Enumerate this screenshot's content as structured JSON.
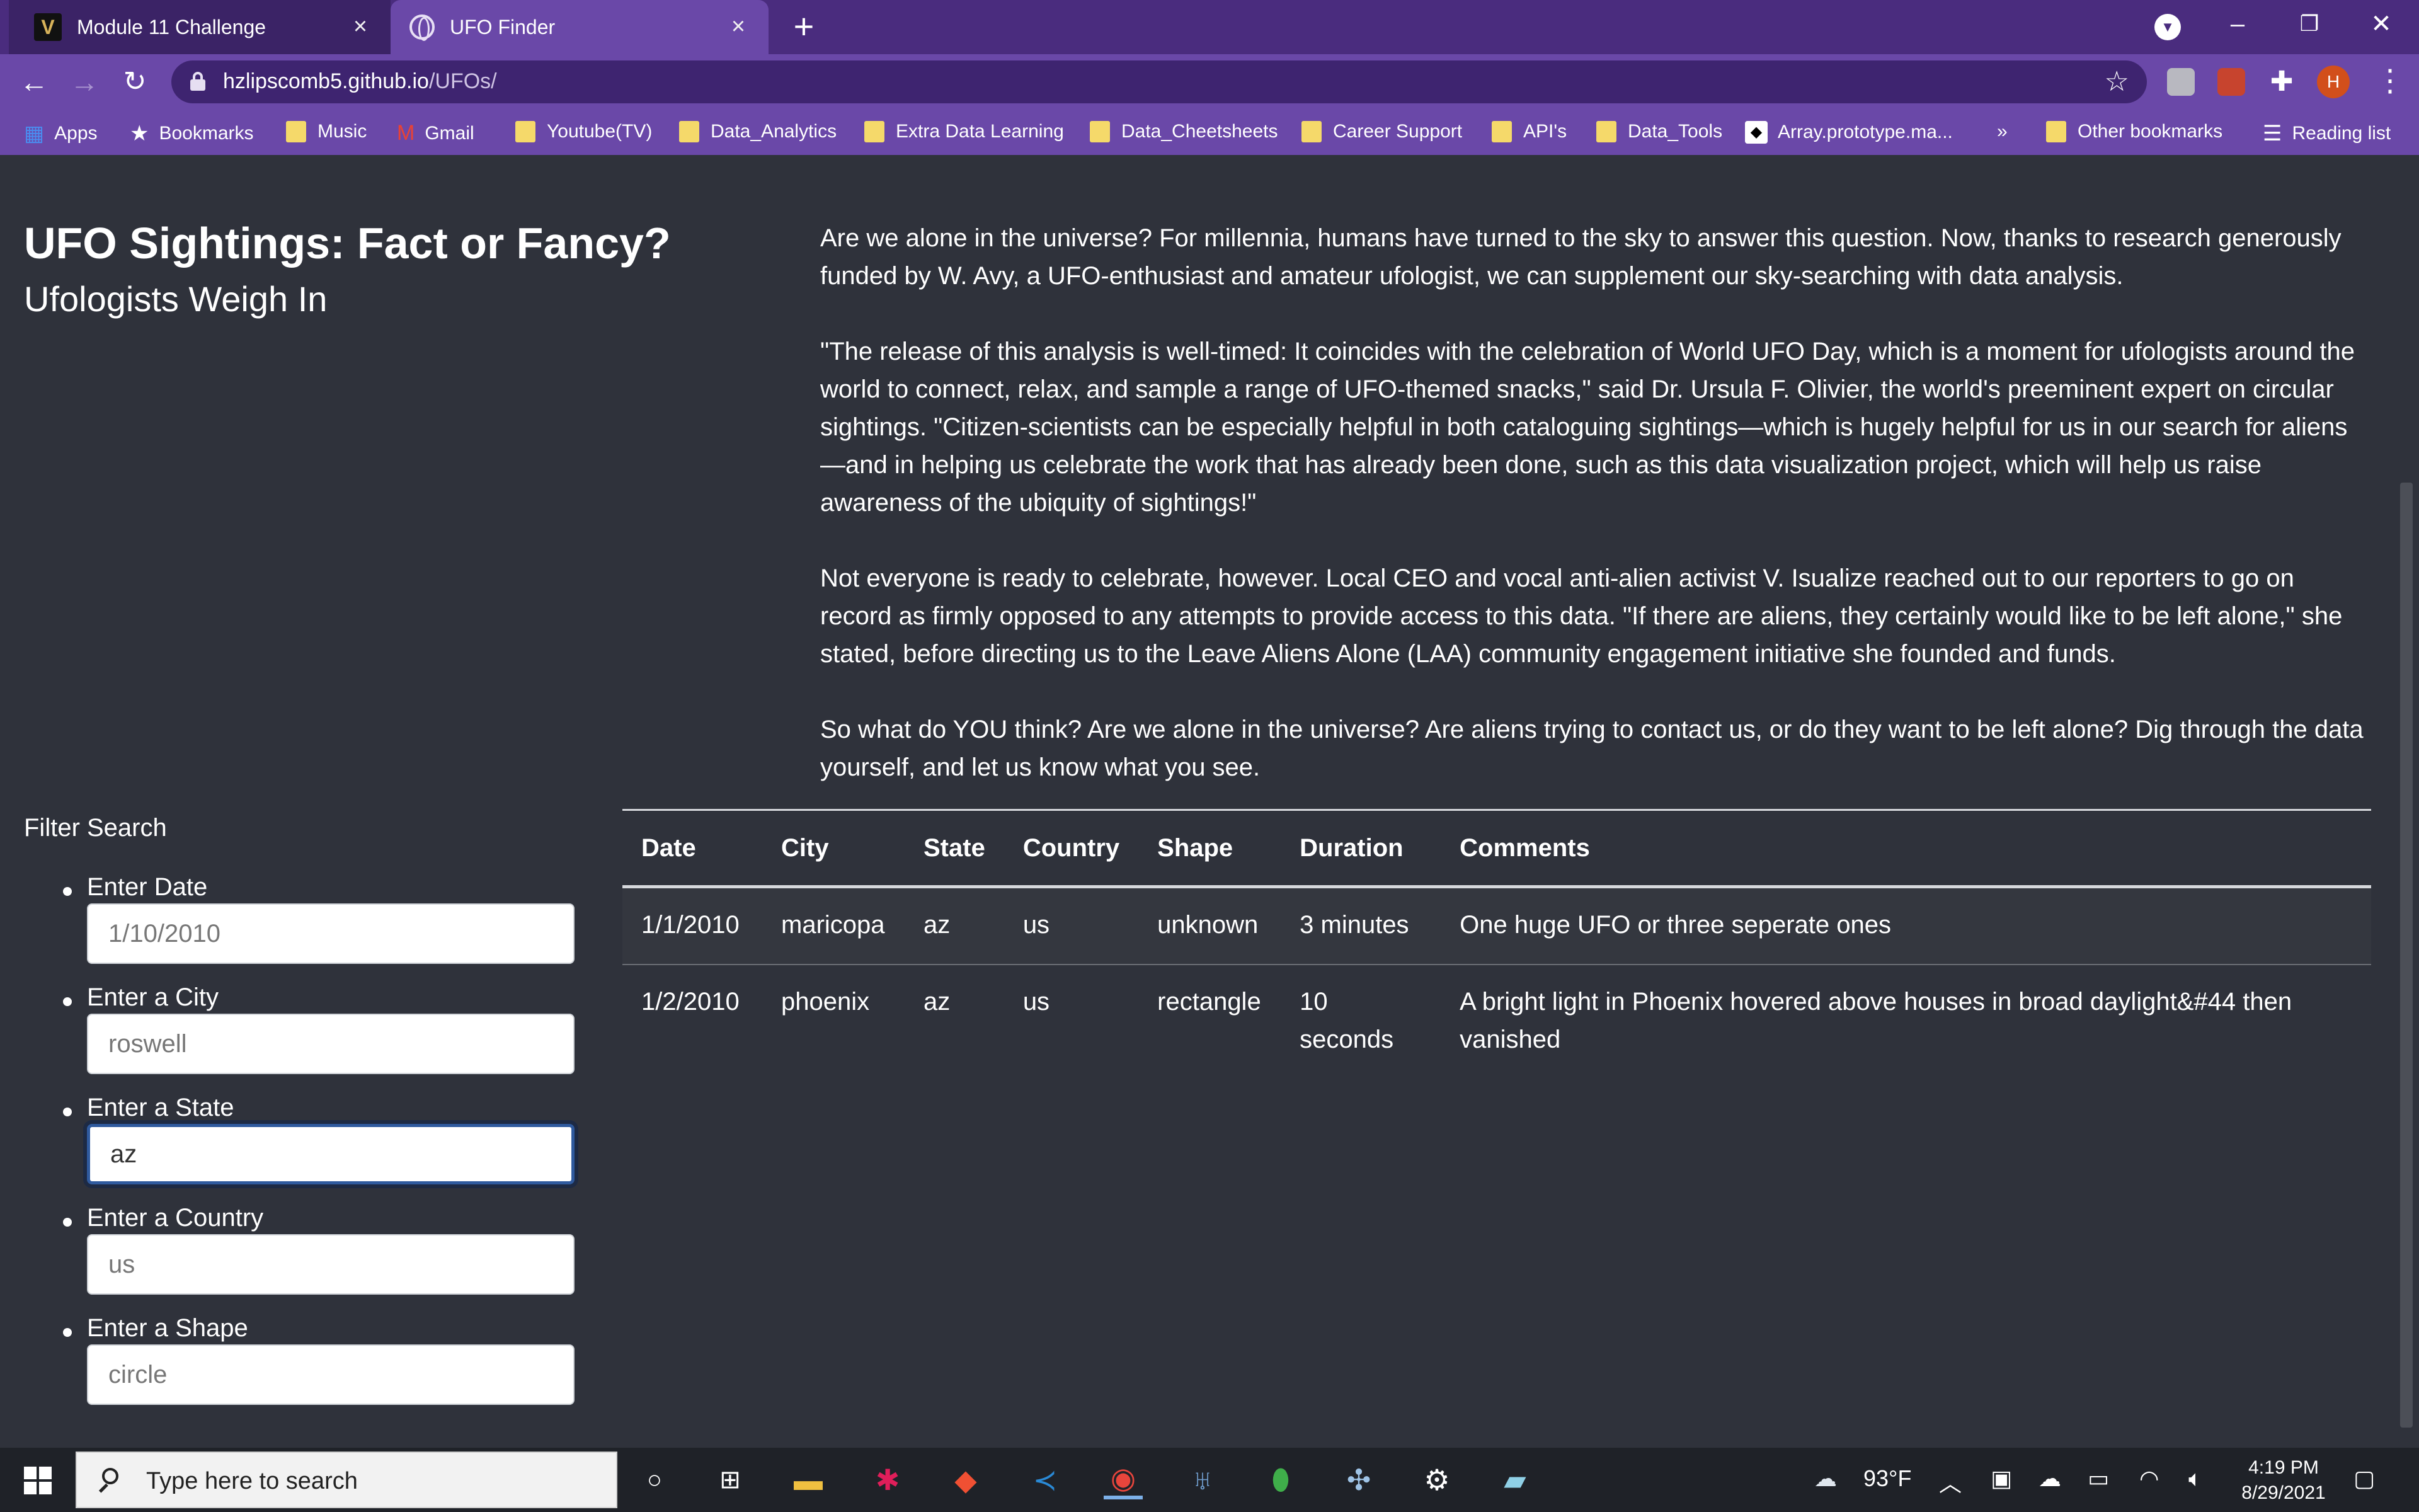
{
  "browser": {
    "tabs": [
      {
        "title": "Module 11 Challenge",
        "favicon": "v-logo-icon",
        "active": false
      },
      {
        "title": "UFO Finder",
        "favicon": "globe-icon",
        "active": true
      }
    ],
    "url_host": "hzlipscomb5.github.io",
    "url_path": "/UFOs/",
    "profile_initial": "H",
    "bookmarks": [
      {
        "label": "Apps",
        "icon": "apps-icon"
      },
      {
        "label": "Bookmarks",
        "icon": "star-icon"
      },
      {
        "label": "Music",
        "icon": "folder-icon"
      },
      {
        "label": "Gmail",
        "icon": "gmail-icon"
      },
      {
        "label": "Youtube(TV)",
        "icon": "folder-icon"
      },
      {
        "label": "Data_Analytics",
        "icon": "folder-icon"
      },
      {
        "label": "Extra Data Learning",
        "icon": "folder-icon"
      },
      {
        "label": "Data_Cheetsheets",
        "icon": "folder-icon"
      },
      {
        "label": "Career Support",
        "icon": "folder-icon"
      },
      {
        "label": "API's",
        "icon": "folder-icon"
      },
      {
        "label": "Data_Tools",
        "icon": "folder-icon"
      },
      {
        "label": "Array.prototype.ma...",
        "icon": "site-icon"
      }
    ],
    "overflow_label": "»",
    "other_bookmarks": "Other bookmarks",
    "reading_list": "Reading list"
  },
  "page": {
    "title": "UFO Sightings: Fact or Fancy?",
    "subtitle": "Ufologists Weigh In",
    "paragraphs": [
      "Are we alone in the universe? For millennia, humans have turned to the sky to answer this question. Now, thanks to research generously funded by W. Avy, a UFO-enthusiast and amateur ufologist, we can supplement our sky-searching with data analysis.",
      "\"The release of this analysis is well-timed: It coincides with the celebration of World UFO Day, which is a moment for ufologists around the world to connect, relax, and sample a range of UFO-themed snacks,\" said Dr. Ursula F. Olivier, the world's preeminent expert on circular sightings. \"Citizen-scientists can be especially helpful in both cataloguing sightings—which is hugely helpful for us in our search for aliens—and in helping us celebrate the work that has already been done, such as this data visualization project, which will help us raise awareness of the ubiquity of sightings!\"",
      "Not everyone is ready to celebrate, however. Local CEO and vocal anti-alien activist V. Isualize reached out to our reporters to go on record as firmly opposed to any attempts to provide access to this data. \"If there are aliens, they certainly would like to be left alone,\" she stated, before directing us to the Leave Aliens Alone (LAA) community engagement initiative she founded and funds.",
      "So what do YOU think? Are we alone in the universe? Are aliens trying to contact us, or do they want to be left alone? Dig through the data yourself, and let us know what you see."
    ],
    "filter_title": "Filter Search",
    "filters": [
      {
        "label": "Enter Date",
        "value": "",
        "placeholder": "1/10/2010"
      },
      {
        "label": "Enter a City",
        "value": "",
        "placeholder": "roswell"
      },
      {
        "label": "Enter a State",
        "value": "az",
        "placeholder": ""
      },
      {
        "label": "Enter a Country",
        "value": "",
        "placeholder": "us"
      },
      {
        "label": "Enter a Shape",
        "value": "",
        "placeholder": "circle"
      }
    ],
    "table": {
      "headers": [
        "Date",
        "City",
        "State",
        "Country",
        "Shape",
        "Duration",
        "Comments"
      ],
      "rows": [
        [
          "1/1/2010",
          "maricopa",
          "az",
          "us",
          "unknown",
          "3 minutes",
          "One huge UFO or three seperate ones"
        ],
        [
          "1/2/2010",
          "phoenix",
          "az",
          "us",
          "rectangle",
          "10 seconds",
          "A bright light in Phoenix hovered above houses in broad daylight&#44 then vanished"
        ]
      ]
    }
  },
  "taskbar": {
    "search_placeholder": "Type here to search",
    "weather": "93°F",
    "time": "4:19 PM",
    "date": "8/29/2021"
  }
}
